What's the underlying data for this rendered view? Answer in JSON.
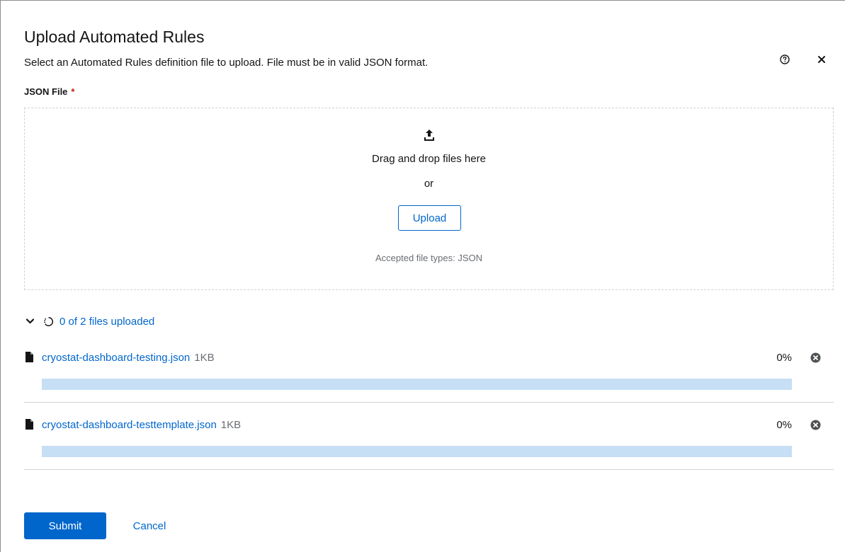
{
  "modal": {
    "title": "Upload Automated Rules",
    "description": "Select an Automated Rules definition file to upload. File must be in valid JSON format.",
    "help_icon": "help-circle-icon",
    "close_icon": "close-icon"
  },
  "field": {
    "label": "JSON File",
    "required_marker": "*"
  },
  "dropzone": {
    "icon": "upload-icon",
    "title": "Drag and drop files here",
    "separator": "or",
    "upload_label": "Upload",
    "accepted_text": "Accepted file types: JSON"
  },
  "status": {
    "toggle_icon": "chevron-down-icon",
    "spinner_icon": "in-progress-icon",
    "text": "0 of 2 files uploaded"
  },
  "files": [
    {
      "name": "cryostat-dashboard-testing.json",
      "size": "1KB",
      "percent_label": "0%",
      "progress": 0
    },
    {
      "name": "cryostat-dashboard-testtemplate.json",
      "size": "1KB",
      "percent_label": "0%",
      "progress": 0
    }
  ],
  "actions": {
    "submit_label": "Submit",
    "cancel_label": "Cancel"
  },
  "colors": {
    "primary": "#0066cc",
    "progress_track": "#c7dff5",
    "required": "#c9190b",
    "muted_text": "#6a6e73"
  }
}
